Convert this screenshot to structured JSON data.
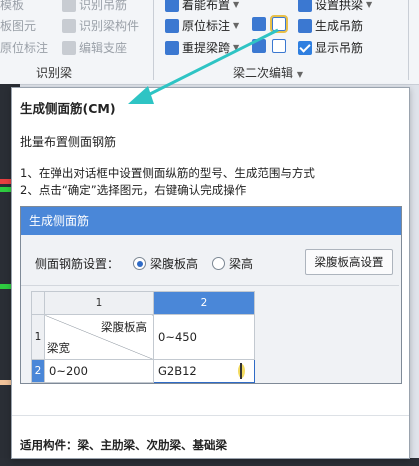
{
  "ribbon": {
    "left_col1": [
      "模板",
      "板图元",
      "原位标注"
    ],
    "left_col2": [
      "识别吊筋",
      "识别梁构件",
      "编辑支座"
    ],
    "group1_label": "识别梁",
    "mid_col1": [
      "着能布置",
      "原位标注",
      "重提梁跨"
    ],
    "mid_icons": [
      "",
      "",
      ""
    ],
    "right_col": [
      "设置拱梁",
      "生成吊筋",
      "显示吊筋"
    ],
    "group2_label": "梁二次编辑"
  },
  "tooltip": {
    "title": "生成侧面筋(CM)",
    "subtitle": "批量布置侧面钢筋",
    "step1": "1、在弹出对话框中设置侧面纵筋的型号、生成范围与方式",
    "step2": "2、点击“确定”选择图元，右键确认完成操作",
    "footer": "适用构件：梁、主肋梁、次肋梁、基础梁"
  },
  "dialog": {
    "title": "生成侧面筋",
    "setting_label": "侧面钢筋设置：",
    "options": [
      "梁腹板高",
      "梁高"
    ],
    "selected_option": "梁腹板高",
    "button_label": "梁腹板高设置",
    "col_headers": [
      "1",
      "2"
    ],
    "diag_top": "梁腹板高",
    "diag_bottom": "梁宽",
    "rows": [
      {
        "num": "1",
        "c1": "",
        "c2": "0~450"
      },
      {
        "num": "2",
        "c1": "0~200",
        "c2": "G2B12"
      }
    ]
  },
  "colors": {
    "accent": "#4a87d8",
    "arrow": "#2ec4c4"
  }
}
